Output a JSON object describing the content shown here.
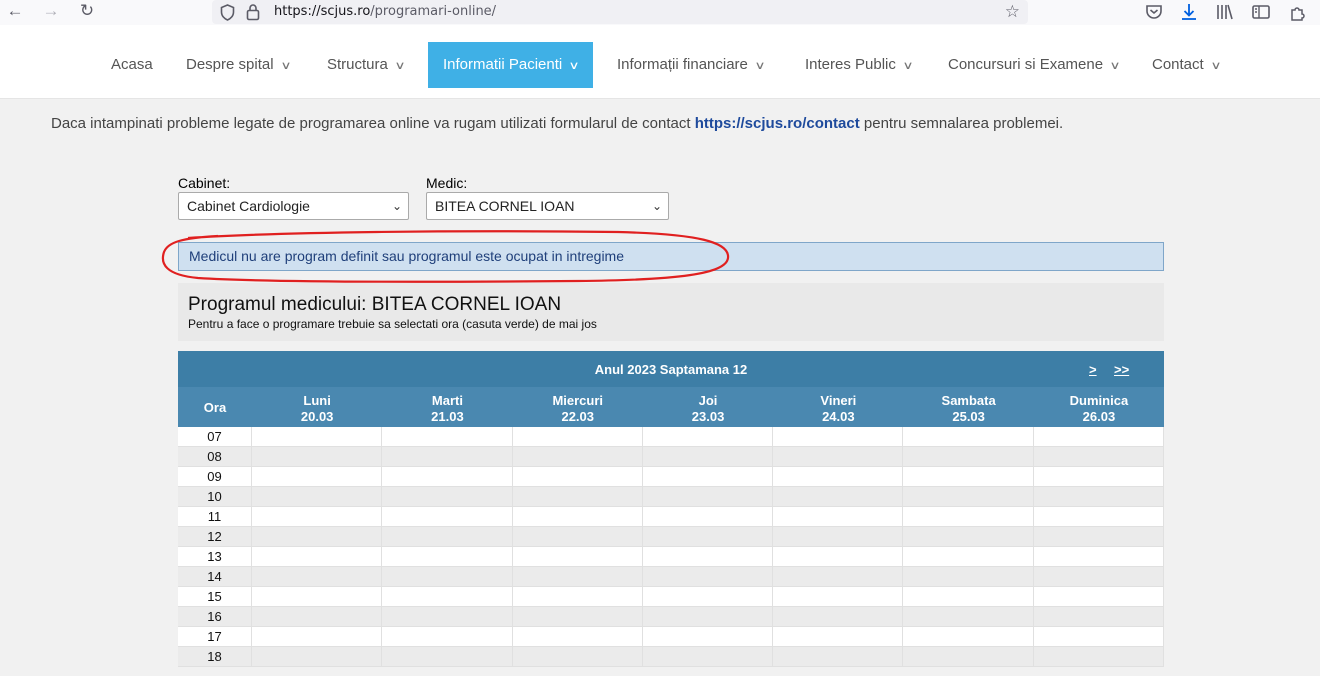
{
  "browser": {
    "url_host": "https://scjus.ro",
    "url_path": "/programari-online/"
  },
  "menu": [
    {
      "label": "Acasa",
      "dropdown": false,
      "active": false
    },
    {
      "label": "Despre spital",
      "dropdown": true,
      "active": false
    },
    {
      "label": "Structura",
      "dropdown": true,
      "active": false
    },
    {
      "label": "Informatii Pacienti",
      "dropdown": true,
      "active": true
    },
    {
      "label": "Informații financiare",
      "dropdown": true,
      "active": false
    },
    {
      "label": "Interes Public",
      "dropdown": true,
      "active": false
    },
    {
      "label": "Concursuri si Examene",
      "dropdown": true,
      "active": false
    },
    {
      "label": "Contact",
      "dropdown": true,
      "active": false
    }
  ],
  "notice": {
    "before": "Daca intampinati probleme legate de programarea online va rugam utilizati formularul de contact ",
    "link": "https://scjus.ro/contact",
    "after": " pentru semnalarea problemei."
  },
  "form": {
    "cabinet_label": "Cabinet:",
    "cabinet_value": "Cabinet Cardiologie",
    "medic_label": "Medic:",
    "medic_value": "BITEA CORNEL IOAN"
  },
  "alert": "Medicul nu are program definit sau programul este ocupat in intregime",
  "program": {
    "title": "Programul medicului: BITEA CORNEL IOAN",
    "subtitle": "Pentru a face o programare trebuie sa selectati ora (casuta verde) de mai jos"
  },
  "calendar": {
    "week_label": "Anul 2023 Saptamana 12",
    "next": ">",
    "next_next": ">>",
    "ora_label": "Ora",
    "days": [
      {
        "name": "Luni",
        "date": "20.03"
      },
      {
        "name": "Marti",
        "date": "21.03"
      },
      {
        "name": "Miercuri",
        "date": "22.03"
      },
      {
        "name": "Joi",
        "date": "23.03"
      },
      {
        "name": "Vineri",
        "date": "24.03"
      },
      {
        "name": "Sambata",
        "date": "25.03"
      },
      {
        "name": "Duminica",
        "date": "26.03"
      }
    ],
    "hours": [
      "07",
      "08",
      "09",
      "10",
      "11",
      "12",
      "13",
      "14",
      "15",
      "16",
      "17",
      "18"
    ]
  },
  "colors": {
    "menu_active": "#3fb0e6",
    "table_header": "#3d7ea6",
    "alert_bg": "#cfe0f0",
    "annotation": "#e02020"
  }
}
